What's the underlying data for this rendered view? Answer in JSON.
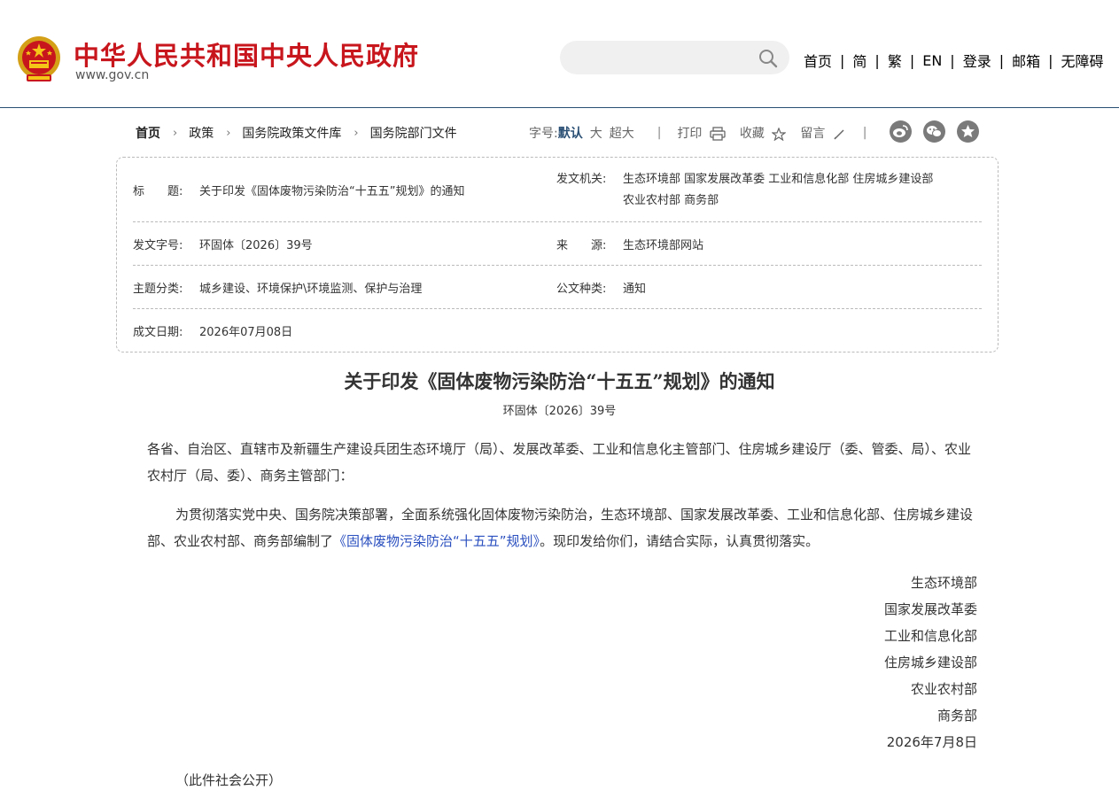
{
  "header": {
    "site_title": "中华人民共和国中央人民政府",
    "site_url": "www.gov.cn",
    "search_placeholder": "",
    "nav": [
      "首页",
      "简",
      "繁",
      "EN",
      "登录",
      "邮箱",
      "无障碍"
    ],
    "nav_separator": "|"
  },
  "breadcrumb": {
    "items": [
      "首页",
      "政策",
      "国务院政策文件库",
      "国务院部门文件"
    ],
    "chevron": "›"
  },
  "tools": {
    "font_size_label": "字号:",
    "font_default": "默认",
    "font_large": "大",
    "font_xlarge": "超大",
    "print": "打印",
    "favorite": "收藏",
    "comment": "留言",
    "separator": "|"
  },
  "share_icons": [
    "weibo-icon",
    "wechat-icon",
    "favorite-star-icon"
  ],
  "info": {
    "title_label": "标　　题:",
    "title_value": "关于印发《固体废物污染防治“十五五”规划》的通知",
    "issuer_label": "发文机关:",
    "issuer_line1": "生态环境部  国家发展改革委  工业和信息化部  住房城乡建设部",
    "issuer_line2": "农业农村部  商务部",
    "docno_label": "发文字号:",
    "docno_value": "环固体〔2026〕39号",
    "source_label": "来　　源:",
    "source_value": "生态环境部网站",
    "topic_label": "主题分类:",
    "topic_value": "城乡建设、环境保护\\环境监测、保护与治理",
    "type_label": "公文种类:",
    "type_value": "通知",
    "date_label": "成文日期:",
    "date_value": "2026年07月08日"
  },
  "article": {
    "title": "关于印发《固体废物污染防治“十五五”规划》的通知",
    "doc_no": "环固体〔2026〕39号",
    "recipients": "各省、自治区、直辖市及新疆生产建设兵团生态环境厅（局）、发展改革委、工业和信息化主管部门、住房城乡建设厅（委、管委、局）、农业农村厅（局、委）、商务主管部门：",
    "body_before": "为贯彻落实党中央、国务院决策部署，全面系统强化固体废物污染防治，生态环境部、国家发展改革委、工业和信息化部、住房城乡建设部、农业农村部、商务部编制了",
    "body_link": "《固体废物污染防治“十五五”规划》",
    "body_after": "。现印发给你们，请结合实际，认真贯彻落实。",
    "signatories": [
      "生态环境部",
      "国家发展改革委",
      "工业和信息化部",
      "住房城乡建设部",
      "农业农村部",
      "商务部"
    ],
    "sign_date": "2026年7月8日",
    "note": "（此件社会公开）"
  },
  "colors": {
    "brand_red": "#c8161d",
    "nav_blue": "#2a4f74",
    "link_blue": "#2a4fbf"
  }
}
